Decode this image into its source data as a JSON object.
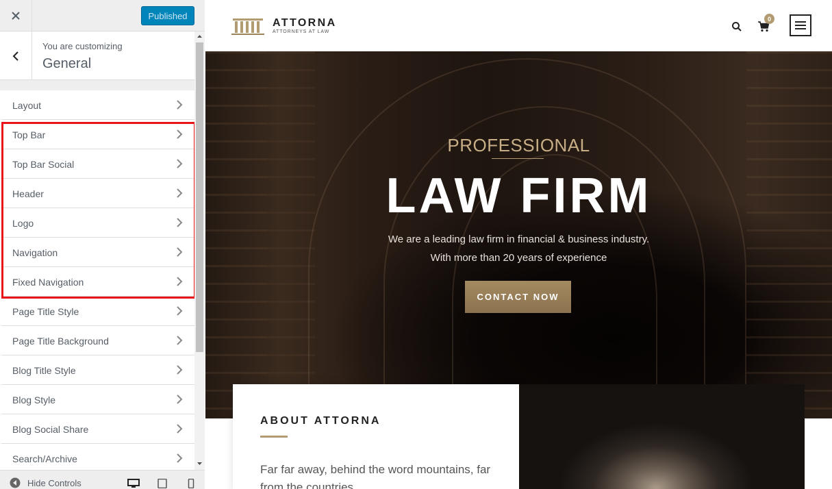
{
  "customizer": {
    "close_icon": "close-icon",
    "publish_label": "Published",
    "info": {
      "small": "You are customizing",
      "title": "General"
    },
    "menu_items": [
      {
        "label": "Layout"
      },
      {
        "label": "Top Bar"
      },
      {
        "label": "Top Bar Social"
      },
      {
        "label": "Header"
      },
      {
        "label": "Logo"
      },
      {
        "label": "Navigation"
      },
      {
        "label": "Fixed Navigation"
      },
      {
        "label": "Page Title Style"
      },
      {
        "label": "Page Title Background"
      },
      {
        "label": "Blog Title Style"
      },
      {
        "label": "Blog Style"
      },
      {
        "label": "Blog Social Share"
      },
      {
        "label": "Search/Archive"
      }
    ],
    "highlight_color": "#e8141a",
    "footer": {
      "hide_controls_label": "Hide Controls",
      "devices": [
        "desktop-icon",
        "tablet-icon",
        "mobile-icon"
      ]
    }
  },
  "site": {
    "logo": {
      "name": "ATTORNA",
      "tagline": "ATTORNEYS AT LAW"
    },
    "cart_count": "0",
    "accent": "#b39b71",
    "hero": {
      "small_title": "PROFESSIONAL",
      "big_title": "LAW FIRM",
      "line1": "We are a leading law firm in financial & business industry.",
      "line2": "With more than 20 years of experience",
      "cta": "CONTACT NOW"
    },
    "about": {
      "title": "ABOUT ATTORNA",
      "text": "Far far away, behind the word mountains, far from the countries"
    }
  }
}
